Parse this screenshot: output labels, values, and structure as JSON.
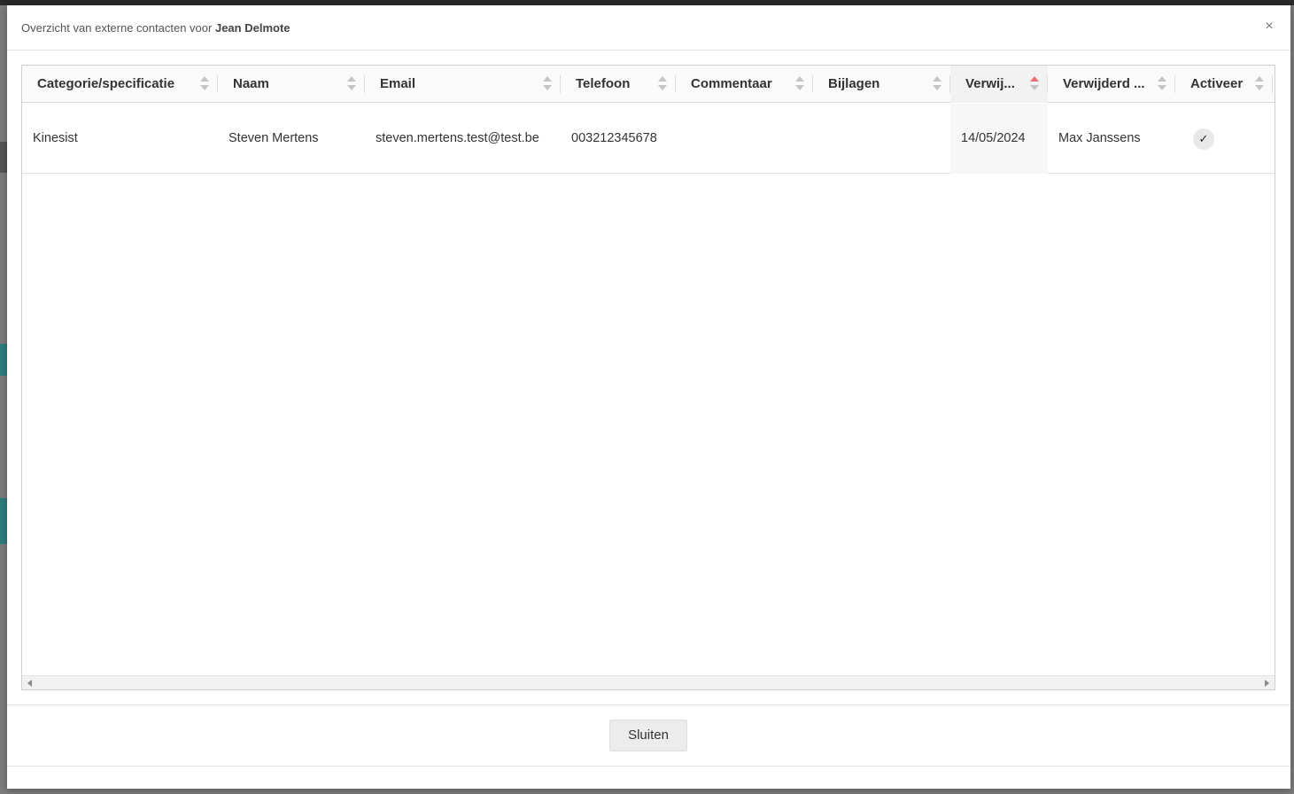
{
  "modal": {
    "title_prefix": "Overzicht van externe contacten voor",
    "title_name": "Jean Delmote",
    "close_symbol": "×"
  },
  "grid": {
    "columns": [
      {
        "label": "Categorie/specificatie"
      },
      {
        "label": "Naam"
      },
      {
        "label": "Email"
      },
      {
        "label": "Telefoon"
      },
      {
        "label": "Commentaar"
      },
      {
        "label": "Bijlagen"
      },
      {
        "label": "Verwij..."
      },
      {
        "label": "Verwijderd ..."
      },
      {
        "label": "Activeer"
      }
    ],
    "rows": [
      {
        "category": "Kinesist",
        "name": "Steven Mertens",
        "email": "steven.mertens.test@test.be",
        "phone": "003212345678",
        "comment": "",
        "attachments": "",
        "deleted_on": "14/05/2024",
        "deleted_by": "Max Janssens",
        "activate_icon": "✓"
      }
    ],
    "sorted_column": "Verwij...",
    "sort_color": "#f06b6b"
  },
  "footer": {
    "close_label": "Sluiten"
  }
}
